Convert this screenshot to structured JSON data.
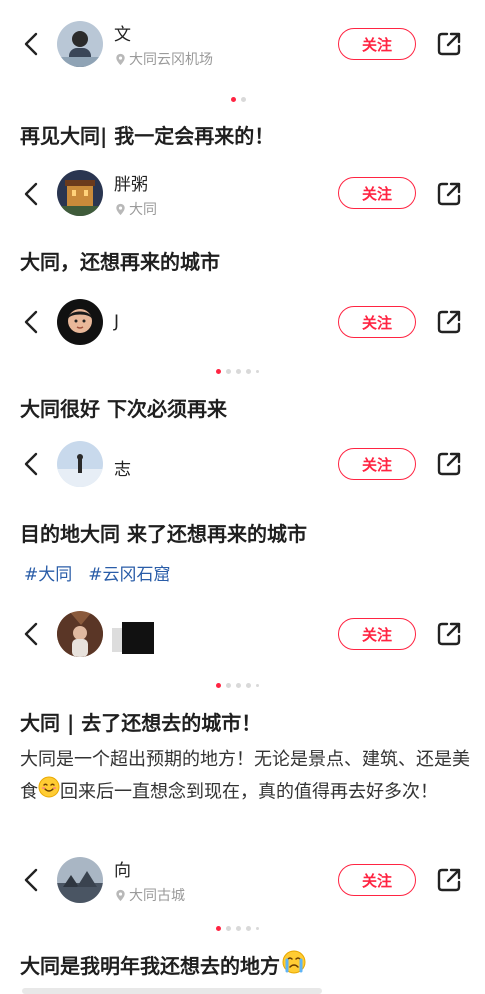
{
  "follow_label": "关注",
  "posts": [
    {
      "username": "文",
      "location": "大同云冈机场",
      "title": "再见大同| 我一定会再来的！"
    },
    {
      "username": "胖粥",
      "location": "大同",
      "title": "大同，还想再来的城市"
    },
    {
      "username": "J",
      "location": "",
      "title": "大同很好 下次必须再来"
    },
    {
      "username": "志",
      "location": "",
      "title": "目的地大同 来了还想再来的城市",
      "tags": [
        "#大同",
        "#云冈石窟"
      ]
    },
    {
      "username": "",
      "location": "",
      "title": "大同 | 去了还想去的城市！",
      "body_before_emoji": "大同是一个超出预期的地方！无论是景点、建筑、还是美食",
      "body_emoji": "blush-emoji",
      "body_after_emoji": "回来后一直想念到现在，真的值得再去好多次！"
    },
    {
      "username": "向",
      "location": "大同古城",
      "title": "大同是我明年我还想去的地方",
      "title_emoji": "crying-emoji"
    }
  ],
  "colors": {
    "accent": "#ff2442",
    "tag": "#2a5da8",
    "muted": "#9a9a9a"
  }
}
